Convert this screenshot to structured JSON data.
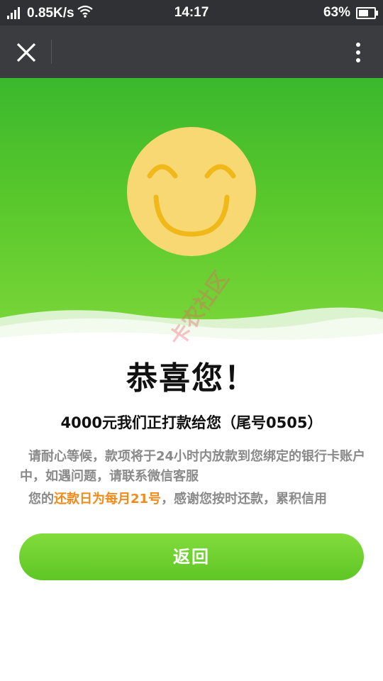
{
  "status_bar": {
    "net_speed": "0.85K/s",
    "time": "14:17",
    "battery_percent": "63%",
    "battery_level": 0.63
  },
  "app_bar": {
    "close_icon": "close-icon",
    "more_icon": "more-vertical-icon"
  },
  "hero": {
    "icon": "smiley-face-icon",
    "colors": {
      "green_top": "#3bb82d",
      "green_bottom": "#7fd83a",
      "face": "#f8d873",
      "features": "#f0b818"
    }
  },
  "content": {
    "headline": "恭喜您！",
    "transfer_text": "4000元我们正打款给您（尾号0505）",
    "notice": "请耐心等候，款项将于24小时内放款到您绑定的银行卡账户中，如遇问题，请联系微信客服",
    "repay_prefix": "您的",
    "repay_highlight": "还款日为每月21号",
    "repay_suffix": "，感谢您按时还款，累积信用"
  },
  "actions": {
    "back_label": "返回"
  },
  "watermark": "卡农社区"
}
